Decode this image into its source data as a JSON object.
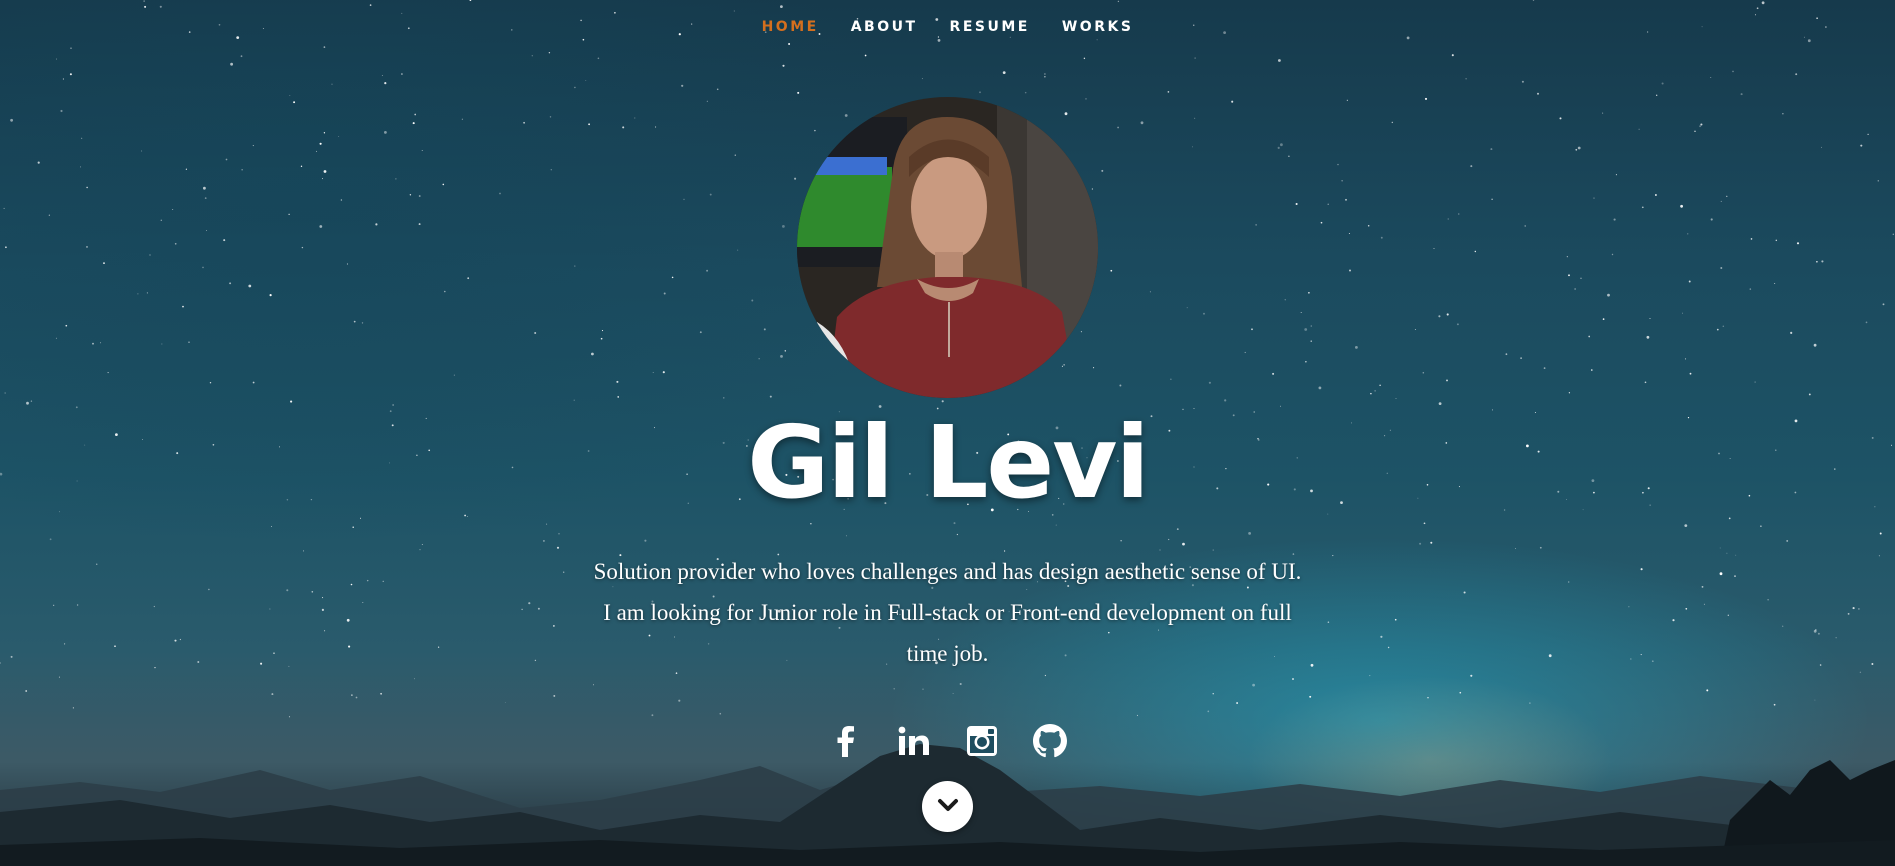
{
  "nav": {
    "items": [
      {
        "label": "HOME",
        "active": true
      },
      {
        "label": "ABOUT",
        "active": false
      },
      {
        "label": "RESUME",
        "active": false
      },
      {
        "label": "WORKS",
        "active": false
      }
    ],
    "active_color": "#d46f1e"
  },
  "hero": {
    "name": "Gil Levi",
    "bio_lines": [
      "Solution provider who loves challenges and has design aesthetic sense of UI.",
      "I am looking for Junior role in Full-stack or Front-end development on full",
      "time job."
    ]
  },
  "social": {
    "icons": [
      "facebook-icon",
      "linkedin-icon",
      "instagram-icon",
      "github-icon"
    ]
  },
  "scroll_icon": "chevron-down-icon"
}
